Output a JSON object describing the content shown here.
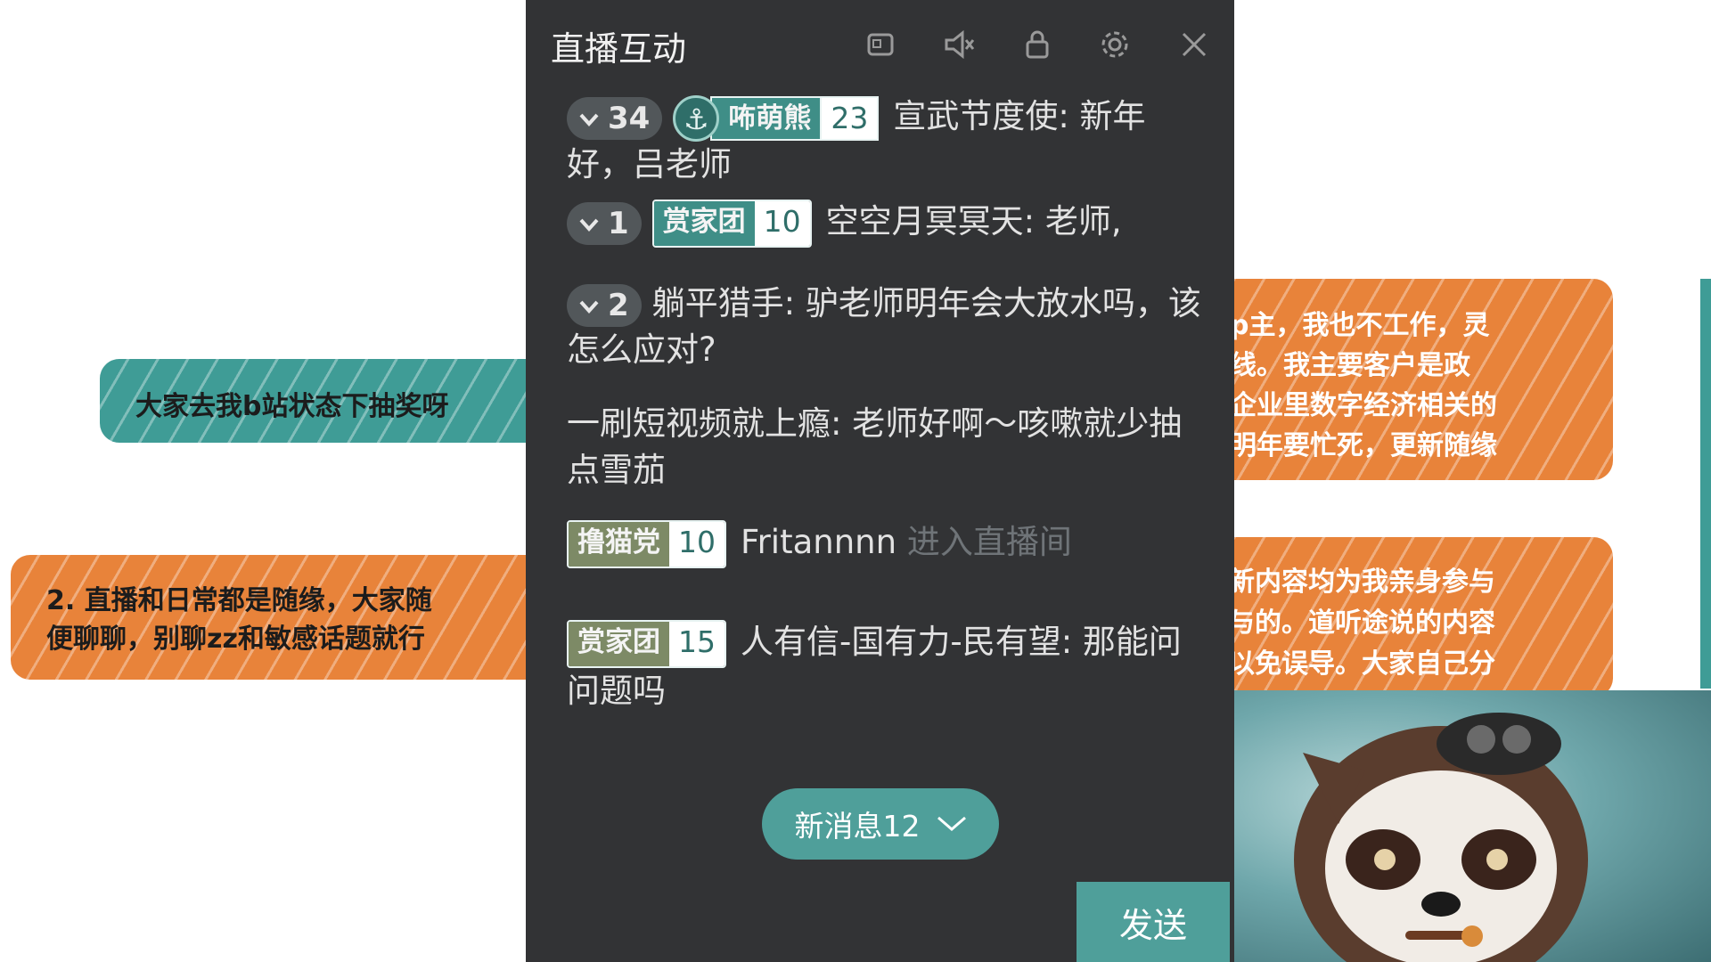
{
  "background": {
    "note_left_1": [
      "大家去我b站状态下抽奖呀"
    ],
    "note_left_2": [
      "2. 直播和日常都是随缘，大家随",
      "便聊聊，别聊zz和敏感话题就行"
    ],
    "note_right_1": [
      "p主，我也不工作，灵",
      "线。我主要客户是政",
      "企业里数字经济相关的",
      "明年要忙死，更新随缘"
    ],
    "note_right_2": [
      "新内容均为我亲身参与",
      "与的。道听途说的内容",
      "以免误导。大家自己分"
    ],
    "colors": {
      "teal": "#3f9c96",
      "orange": "#e8833a"
    }
  },
  "panel": {
    "title": "直播互动",
    "icons": [
      "window-icon",
      "mute-icon",
      "lock-icon",
      "settings-icon",
      "close-icon"
    ],
    "new_messages_label": "新消息12",
    "send_label": "发送"
  },
  "messages": [
    {
      "level": "34",
      "badge": "咘萌熊",
      "badge_level": "23",
      "badge_anchor": true,
      "user": "宣武节度使",
      "text": ": 新年好，吕老师"
    },
    {
      "level": "1",
      "badge": "赏家团",
      "badge_level": "10",
      "user": "空空月冥冥天",
      "text": ": 老师,"
    },
    {
      "level": "2",
      "user": "躺平猎手",
      "text": ": 驴老师明年会大放水吗，该怎么应对?"
    },
    {
      "user": "一刷短视频就上瘾",
      "text": ": 老师好啊～咳嗽就少抽点雪茄"
    },
    {
      "badge": "撸猫党",
      "badge_level": "10",
      "user": "Fritannnn",
      "system": "进入直播间"
    },
    {
      "badge": "赏家团",
      "badge_level": "15",
      "user": "人有信-国有力-民有望",
      "text": ": 那能问问题吗"
    }
  ]
}
